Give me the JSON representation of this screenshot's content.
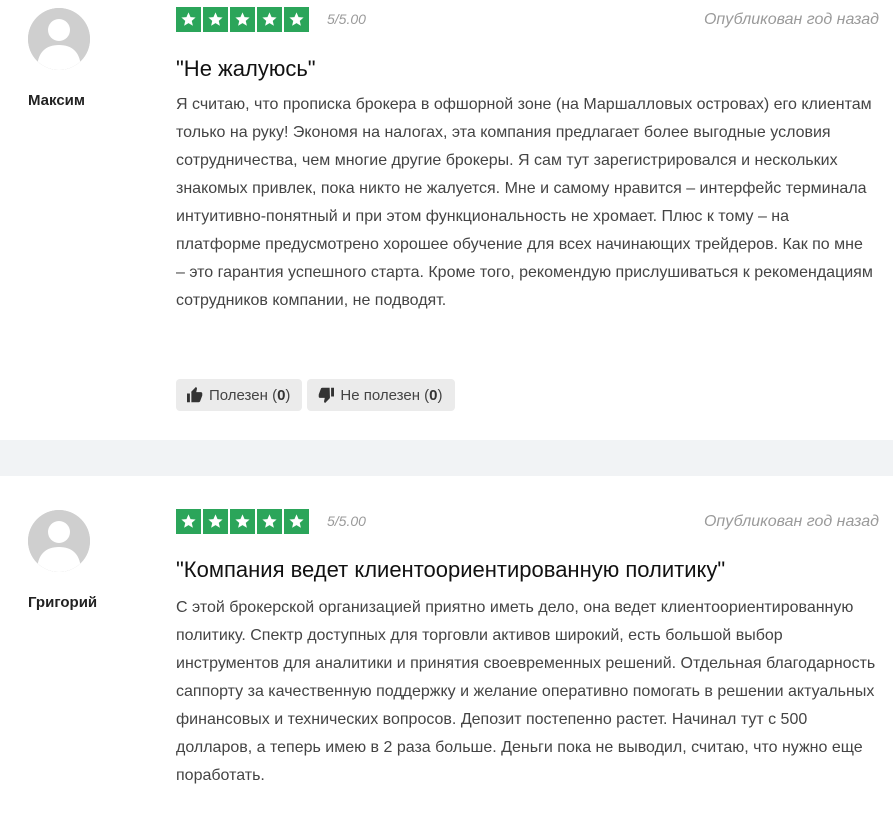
{
  "reviews": [
    {
      "author": "Максим",
      "rating": 5,
      "score_text": "5/5.00",
      "published": "Опубликован год назад",
      "title": "\"Не жалуюсь\"",
      "text": "Я считаю, что прописка брокера в офшорной зоне (на Маршалловых островах) его клиентам только на руку! Экономя на налогах, эта компания предлагает более выгодные условия сотрудничества, чем многие другие брокеры. Я сам тут зарегистрировался и нескольких знакомых привлек, пока никто не жалуется. Мне и самому нравится – интерфейс терминала интуитивно-понятный и при этом функциональность не хромает. Плюс к тому – на платформе предусмотрено хорошее обучение для всех начинающих трейдеров. Как по мне – это гарантия успешного старта. Кроме того, рекомендую прислушиваться к рекомендациям сотрудников компании, не подводят.",
      "helpful_label": "Полезен",
      "helpful_count": "0",
      "not_helpful_label": "Не полезен",
      "not_helpful_count": "0"
    },
    {
      "author": "Григорий",
      "rating": 5,
      "score_text": "5/5.00",
      "published": "Опубликован год назад",
      "title": "\"Компания ведет клиентоориентированную политику\"",
      "text": "С этой брокерской организацией приятно иметь дело, она ведет клиентоориентированную политику. Спектр доступных для торговли активов широкий, есть большой выбор инструментов для аналитики и принятия своевременных решений. Отдельная благодарность саппорту за качественную поддержку и желание оперативно помогать в решении актуальных финансовых и технических вопросов. Депозит постепенно растет. Начинал тут с 500 долларов, а теперь имею в 2 раза больше. Деньги пока не выводил, считаю, что нужно еще поработать."
    }
  ],
  "colors": {
    "star_bg": "#2ba55a",
    "band_bg": "#f1f3f5",
    "avatar_bg": "#cfcfcf"
  },
  "icons": {
    "star": "star-icon",
    "thumb_up": "thumb-up-icon",
    "thumb_down": "thumb-down-icon",
    "avatar": "user-silhouette-icon"
  }
}
